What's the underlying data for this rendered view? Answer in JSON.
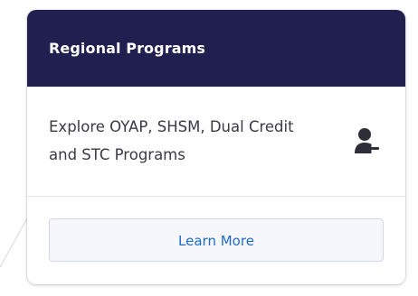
{
  "card": {
    "title": "Regional Programs",
    "description": "Explore OYAP, SHSM, Dual Credit and STC Programs",
    "icon": "user-remove-icon",
    "button_label": "Learn More"
  },
  "colors": {
    "header_bg": "#201f4f",
    "header_text": "#ffffff",
    "button_text": "#1f6cc8",
    "button_bg": "#f6f7fd",
    "icon": "#2e2e3a"
  }
}
